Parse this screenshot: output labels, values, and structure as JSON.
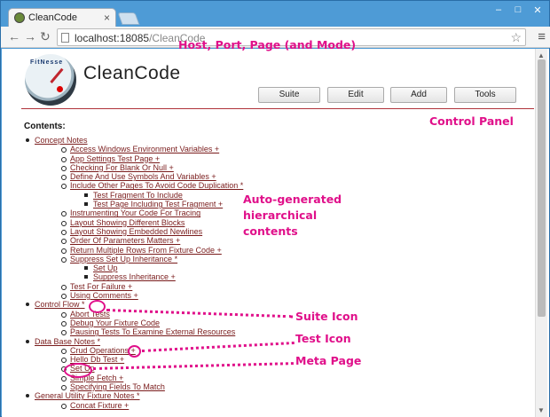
{
  "browser": {
    "tab_title": "CleanCode",
    "url_host": "localhost:18085",
    "url_path": "/CleanCode"
  },
  "page": {
    "brand": "CleanCode",
    "logo_text": "FitNesse",
    "buttons": [
      "Suite",
      "Edit",
      "Add",
      "Tools"
    ],
    "contents_heading": "Contents:"
  },
  "toc": [
    {
      "level": 1,
      "text": "Concept Notes"
    },
    {
      "level": 2,
      "text": "Access Windows Environment Variables +"
    },
    {
      "level": 2,
      "text": "App Settings Test Page +"
    },
    {
      "level": 2,
      "text": "Checking For Blank Or Null +"
    },
    {
      "level": 2,
      "text": "Define And Use Symbols And Variables +"
    },
    {
      "level": 2,
      "text": "Include Other Pages To Avoid Code Duplication *"
    },
    {
      "level": 3,
      "text": "Test Fragment To Include"
    },
    {
      "level": 3,
      "text": "Test Page Including Test Fragment +"
    },
    {
      "level": 2,
      "text": "Instrumenting Your Code For Tracing"
    },
    {
      "level": 2,
      "text": "Layout Showing Different Blocks"
    },
    {
      "level": 2,
      "text": "Layout Showing Embedded Newlines"
    },
    {
      "level": 2,
      "text": "Order Of Parameters Matters +"
    },
    {
      "level": 2,
      "text": "Return Multiple Rows From Fixture Code +"
    },
    {
      "level": 2,
      "text": "Suppress Set Up Inheritance *"
    },
    {
      "level": 3,
      "text": "Set Up"
    },
    {
      "level": 3,
      "text": "Suppress Inheritance +"
    },
    {
      "level": 2,
      "text": "Test For Failure +"
    },
    {
      "level": 2,
      "text": "Using Comments +"
    },
    {
      "level": 1,
      "text": "Control Flow *"
    },
    {
      "level": 2,
      "text": "Abort Tests"
    },
    {
      "level": 2,
      "text": "Debug Your Fixture Code"
    },
    {
      "level": 2,
      "text": "Pausing Tests To Examine External Resources"
    },
    {
      "level": 1,
      "text": "Data Base Notes *"
    },
    {
      "level": 2,
      "text": "Crud Operations +"
    },
    {
      "level": 2,
      "text": "Hello Db Test +"
    },
    {
      "level": 2,
      "text": "Set Up"
    },
    {
      "level": 2,
      "text": "Simple Fetch +"
    },
    {
      "level": 2,
      "text": "Specifying Fields To Match"
    },
    {
      "level": 1,
      "text": "General Utility Fixture Notes *"
    },
    {
      "level": 2,
      "text": "Concat Fixture +"
    }
  ],
  "annotations": {
    "host_port": "Host, Port, Page (and Mode)",
    "control_panel": "Control Panel",
    "auto_line1": "Auto-generated",
    "auto_line2": "hierarchical",
    "auto_line3": "contents",
    "suite_icon": "Suite Icon",
    "test_icon": "Test Icon",
    "meta_page": "Meta Page"
  },
  "colors": {
    "annotation": "#e0108a",
    "link": "#7a1c1c",
    "rule": "#b0333a"
  }
}
